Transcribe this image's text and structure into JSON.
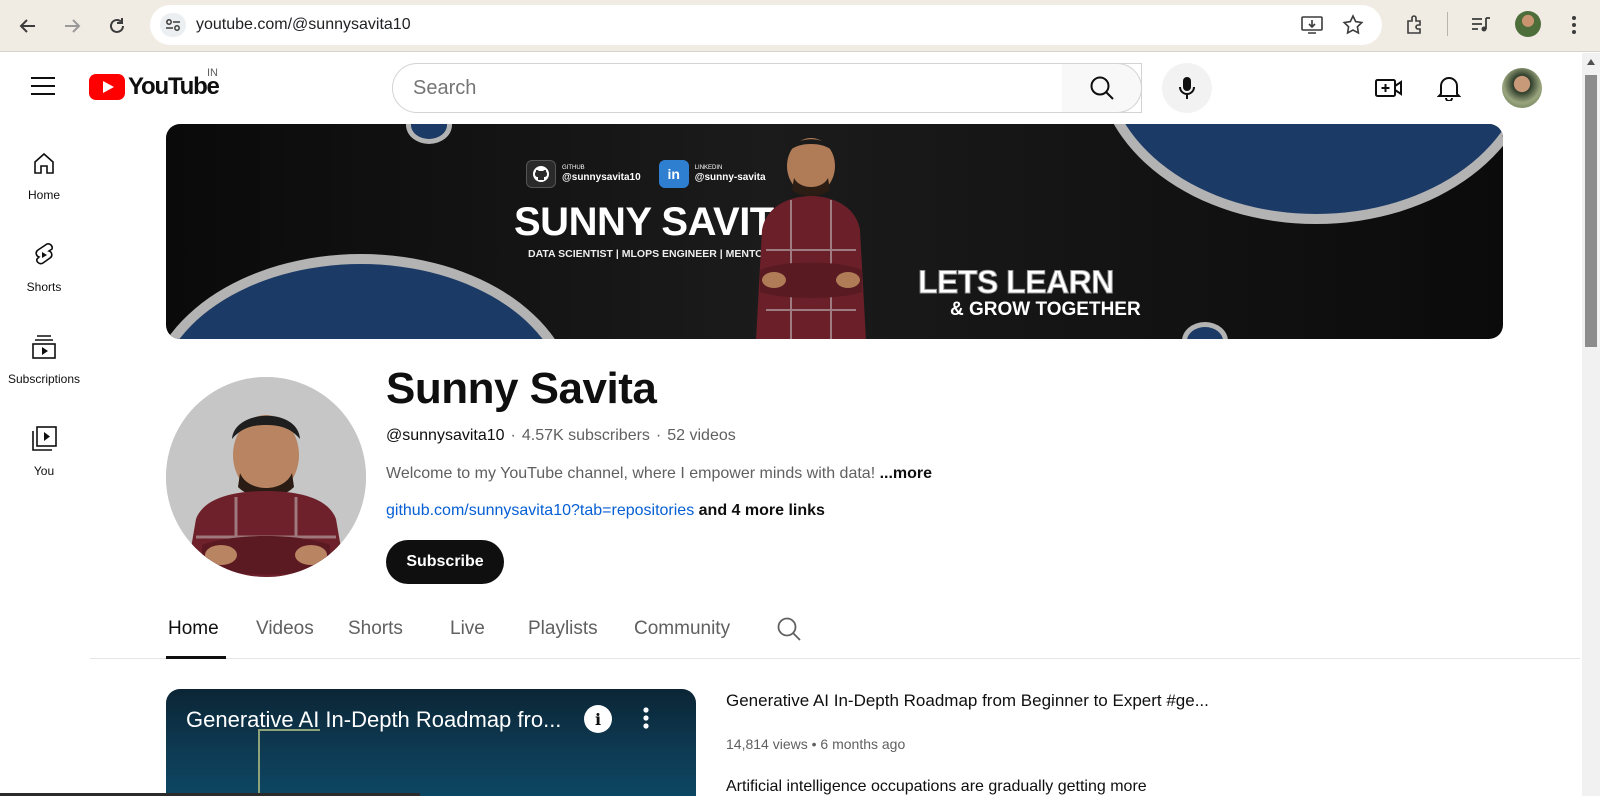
{
  "browser": {
    "url": "youtube.com/@sunnysavita10"
  },
  "header": {
    "logo_text": "YouTube",
    "country_code": "IN",
    "search_placeholder": "Search"
  },
  "sidebar": {
    "items": [
      {
        "label": "Home",
        "icon": "home-icon"
      },
      {
        "label": "Shorts",
        "icon": "shorts-icon"
      },
      {
        "label": "Subscriptions",
        "icon": "subscriptions-icon"
      },
      {
        "label": "You",
        "icon": "you-icon"
      }
    ]
  },
  "banner": {
    "github_caption": "GITHUB",
    "github_handle": "@sunnysavita10",
    "linkedin_caption": "LINKEDIN",
    "linkedin_handle": "@sunny-savita",
    "name": "SUNNY SAVITA",
    "tagline": "DATA SCIENTIST | MLOPS ENGINEER | MENTOR",
    "slogan_line1": "LETS LEARN",
    "slogan_line2": "& GROW TOGETHER"
  },
  "channel": {
    "name": "Sunny Savita",
    "handle": "@sunnysavita10",
    "subscribers": "4.57K subscribers",
    "videos": "52 videos",
    "description": "Welcome to my YouTube channel, where I empower minds with data!",
    "description_more": "...more",
    "link": "github.com/sunnysavita10?tab=repositories",
    "more_links": "and 4 more links",
    "subscribe_label": "Subscribe"
  },
  "tabs": [
    {
      "label": "Home",
      "active": true
    },
    {
      "label": "Videos",
      "active": false
    },
    {
      "label": "Shorts",
      "active": false
    },
    {
      "label": "Live",
      "active": false
    },
    {
      "label": "Playlists",
      "active": false
    },
    {
      "label": "Community",
      "active": false
    }
  ],
  "featured_video": {
    "thumb_title": "Generative AI In-Depth Roadmap fro...",
    "title": "Generative AI In-Depth Roadmap from Beginner to Expert #ge...",
    "views": "14,814 views",
    "age": "6 months ago",
    "description": "Artificial intelligence occupations are gradually getting more"
  },
  "colors": {
    "brand_red": "#ff0000",
    "link_blue": "#065fd4",
    "banner_circle_blue": "#1c3a66"
  }
}
